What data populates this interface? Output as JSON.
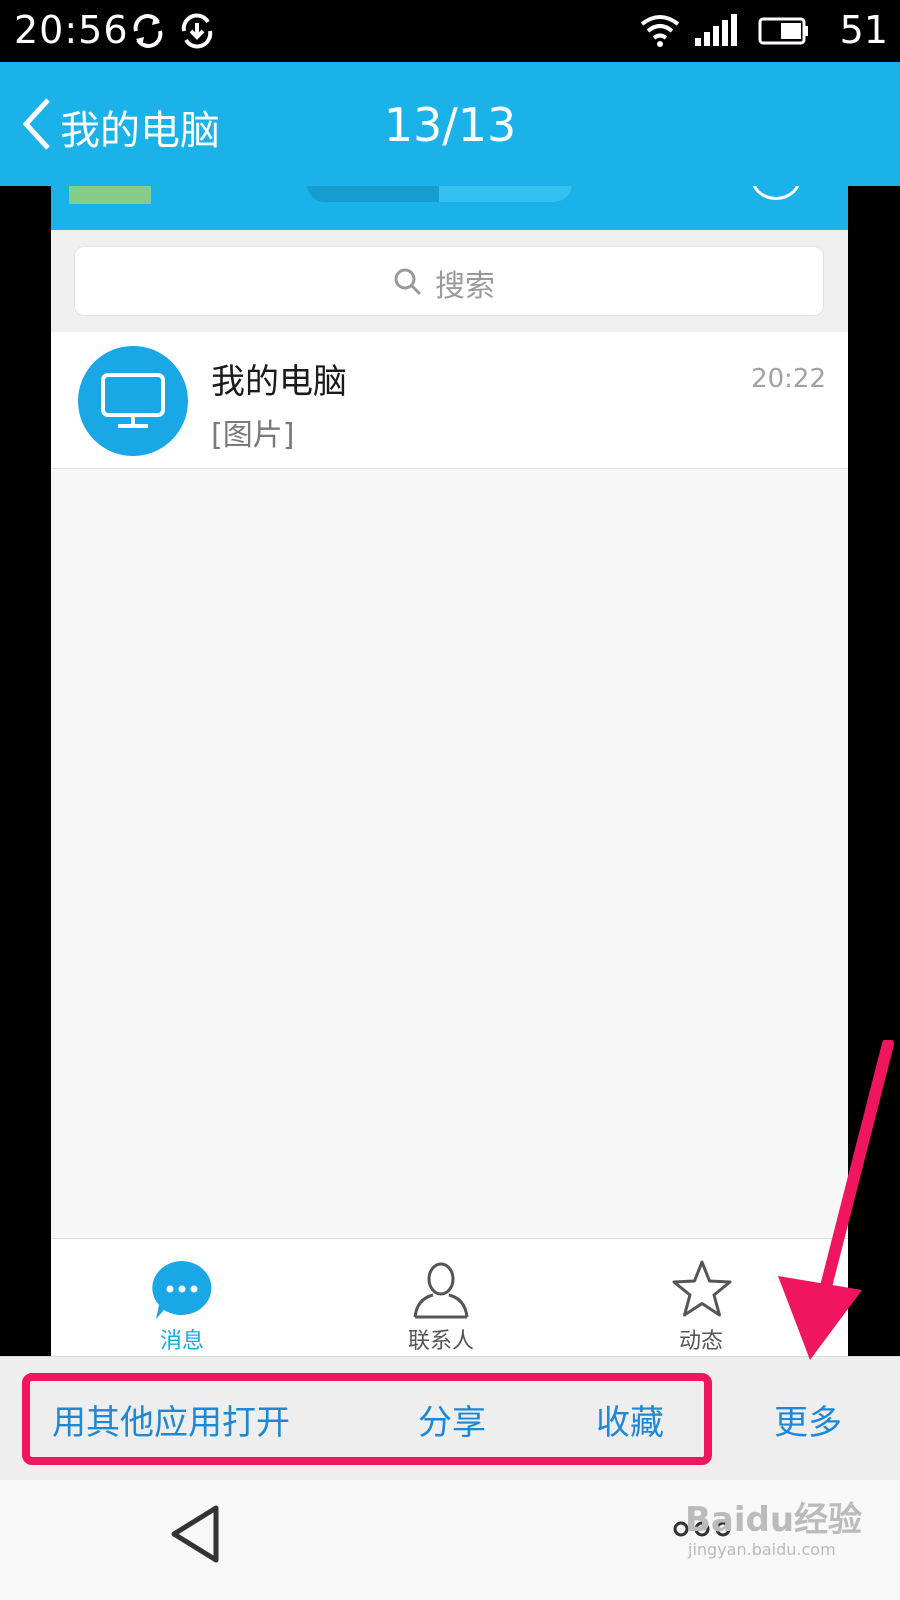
{
  "status_bar": {
    "time": "20:56",
    "battery": "51"
  },
  "header": {
    "title": "我的电脑",
    "counter": "13/13"
  },
  "inner_screen": {
    "search_placeholder": "搜索",
    "chat": {
      "name": "我的电脑",
      "preview": "[图片]",
      "time": "20:22"
    },
    "tabs": [
      {
        "label": "消息"
      },
      {
        "label": "联系人"
      },
      {
        "label": "动态"
      }
    ]
  },
  "actions": {
    "open_with": "用其他应用打开",
    "share": "分享",
    "favorite": "收藏",
    "more": "更多"
  },
  "watermark": {
    "logo": "Baidu经验",
    "url": "jingyan.baidu.com"
  },
  "colors": {
    "accent": "#1ab2e8",
    "highlight": "#f0155f",
    "action_text": "#1e88d6"
  }
}
